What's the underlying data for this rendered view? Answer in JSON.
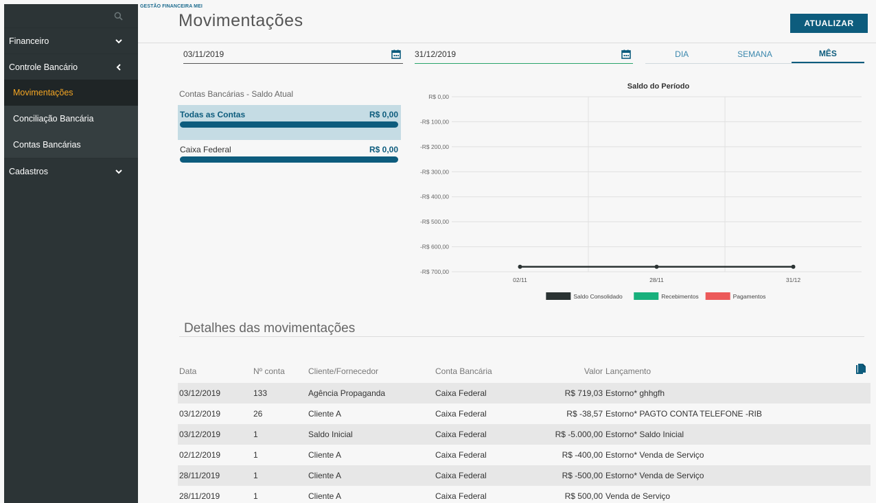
{
  "app": {
    "brand": "GESTÃO FINANCEIRA MEI",
    "page_title": "Movimentações",
    "update_label": "ATUALIZAR"
  },
  "sidebar": {
    "items": [
      {
        "label": "Financeiro",
        "chevron": "down"
      },
      {
        "label": "Controle Bancário",
        "chevron": "left"
      },
      {
        "label": "Cadastros",
        "chevron": "down"
      }
    ],
    "submenu": [
      {
        "label": "Movimentações",
        "active": true
      },
      {
        "label": "Conciliação Bancária"
      },
      {
        "label": "Contas Bancárias"
      }
    ]
  },
  "filters": {
    "start_date": "03/11/2019",
    "end_date": "31/12/2019",
    "tabs": [
      {
        "label": "DIA"
      },
      {
        "label": "SEMANA"
      },
      {
        "label": "MÊS",
        "active": true
      }
    ]
  },
  "accounts": {
    "title": "Contas Bancárias - Saldo Atual",
    "items": [
      {
        "name": "Todas as Contas",
        "value": "R$ 0,00"
      },
      {
        "name": "Caixa Federal",
        "value": "R$ 0,00"
      }
    ]
  },
  "chart_data": {
    "type": "line",
    "title": "Saldo do Período",
    "categories": [
      "02/11",
      "28/11",
      "31/12"
    ],
    "y_ticks": [
      "R$ 0,00",
      "-R$ 100,00",
      "-R$ 200,00",
      "-R$ 300,00",
      "-R$ 400,00",
      "-R$ 500,00",
      "-R$ 600,00",
      "-R$ 700,00"
    ],
    "ylim": [
      -700,
      0
    ],
    "series": [
      {
        "name": "Saldo Consolidado",
        "color": "#2b3333",
        "values": [
          -680,
          -680,
          -680
        ]
      }
    ],
    "legend": [
      {
        "name": "Saldo Consolidado",
        "color": "#2b3333"
      },
      {
        "name": "Recebimentos",
        "color": "#18b07c"
      },
      {
        "name": "Pagamentos",
        "color": "#ec5a5a"
      }
    ],
    "legend_position": "bottom",
    "grid": true
  },
  "details": {
    "title": "Detalhes das movimentações",
    "columns": {
      "data": "Data",
      "conta": "Nº conta",
      "cliente": "Cliente/Fornecedor",
      "banco": "Conta Bancária",
      "valor": "Valor",
      "lancamento": "Lançamento"
    },
    "rows": [
      {
        "data": "03/12/2019",
        "conta": "133",
        "cliente": "Agência Propaganda",
        "banco": "Caixa Federal",
        "valor": "R$ 719,03",
        "lancamento": "Estorno* ghhgfh"
      },
      {
        "data": "03/12/2019",
        "conta": "26",
        "cliente": "Cliente A",
        "banco": "Caixa Federal",
        "valor": "R$ -38,57",
        "lancamento": "Estorno* PAGTO CONTA TELEFONE -RIB"
      },
      {
        "data": "03/12/2019",
        "conta": "1",
        "cliente": "Saldo Inicial",
        "banco": "Caixa Federal",
        "valor": "R$ -5.000,00",
        "lancamento": "Estorno* Saldo Inicial"
      },
      {
        "data": "02/12/2019",
        "conta": "1",
        "cliente": "Cliente A",
        "banco": "Caixa Federal",
        "valor": "R$ -400,00",
        "lancamento": "Estorno* Venda de Serviço"
      },
      {
        "data": "28/11/2019",
        "conta": "1",
        "cliente": "Cliente A",
        "banco": "Caixa Federal",
        "valor": "R$ -500,00",
        "lancamento": "Estorno* Venda de Serviço"
      },
      {
        "data": "28/11/2019",
        "conta": "1",
        "cliente": "Cliente A",
        "banco": "Caixa Federal",
        "valor": "R$ 500,00",
        "lancamento": "Venda de Serviço"
      }
    ]
  },
  "colors": {
    "primary": "#0d5c7d",
    "sidebar": "#2c3436",
    "active_menu": "#f5a623",
    "end_date_underline": "#28a36a"
  }
}
